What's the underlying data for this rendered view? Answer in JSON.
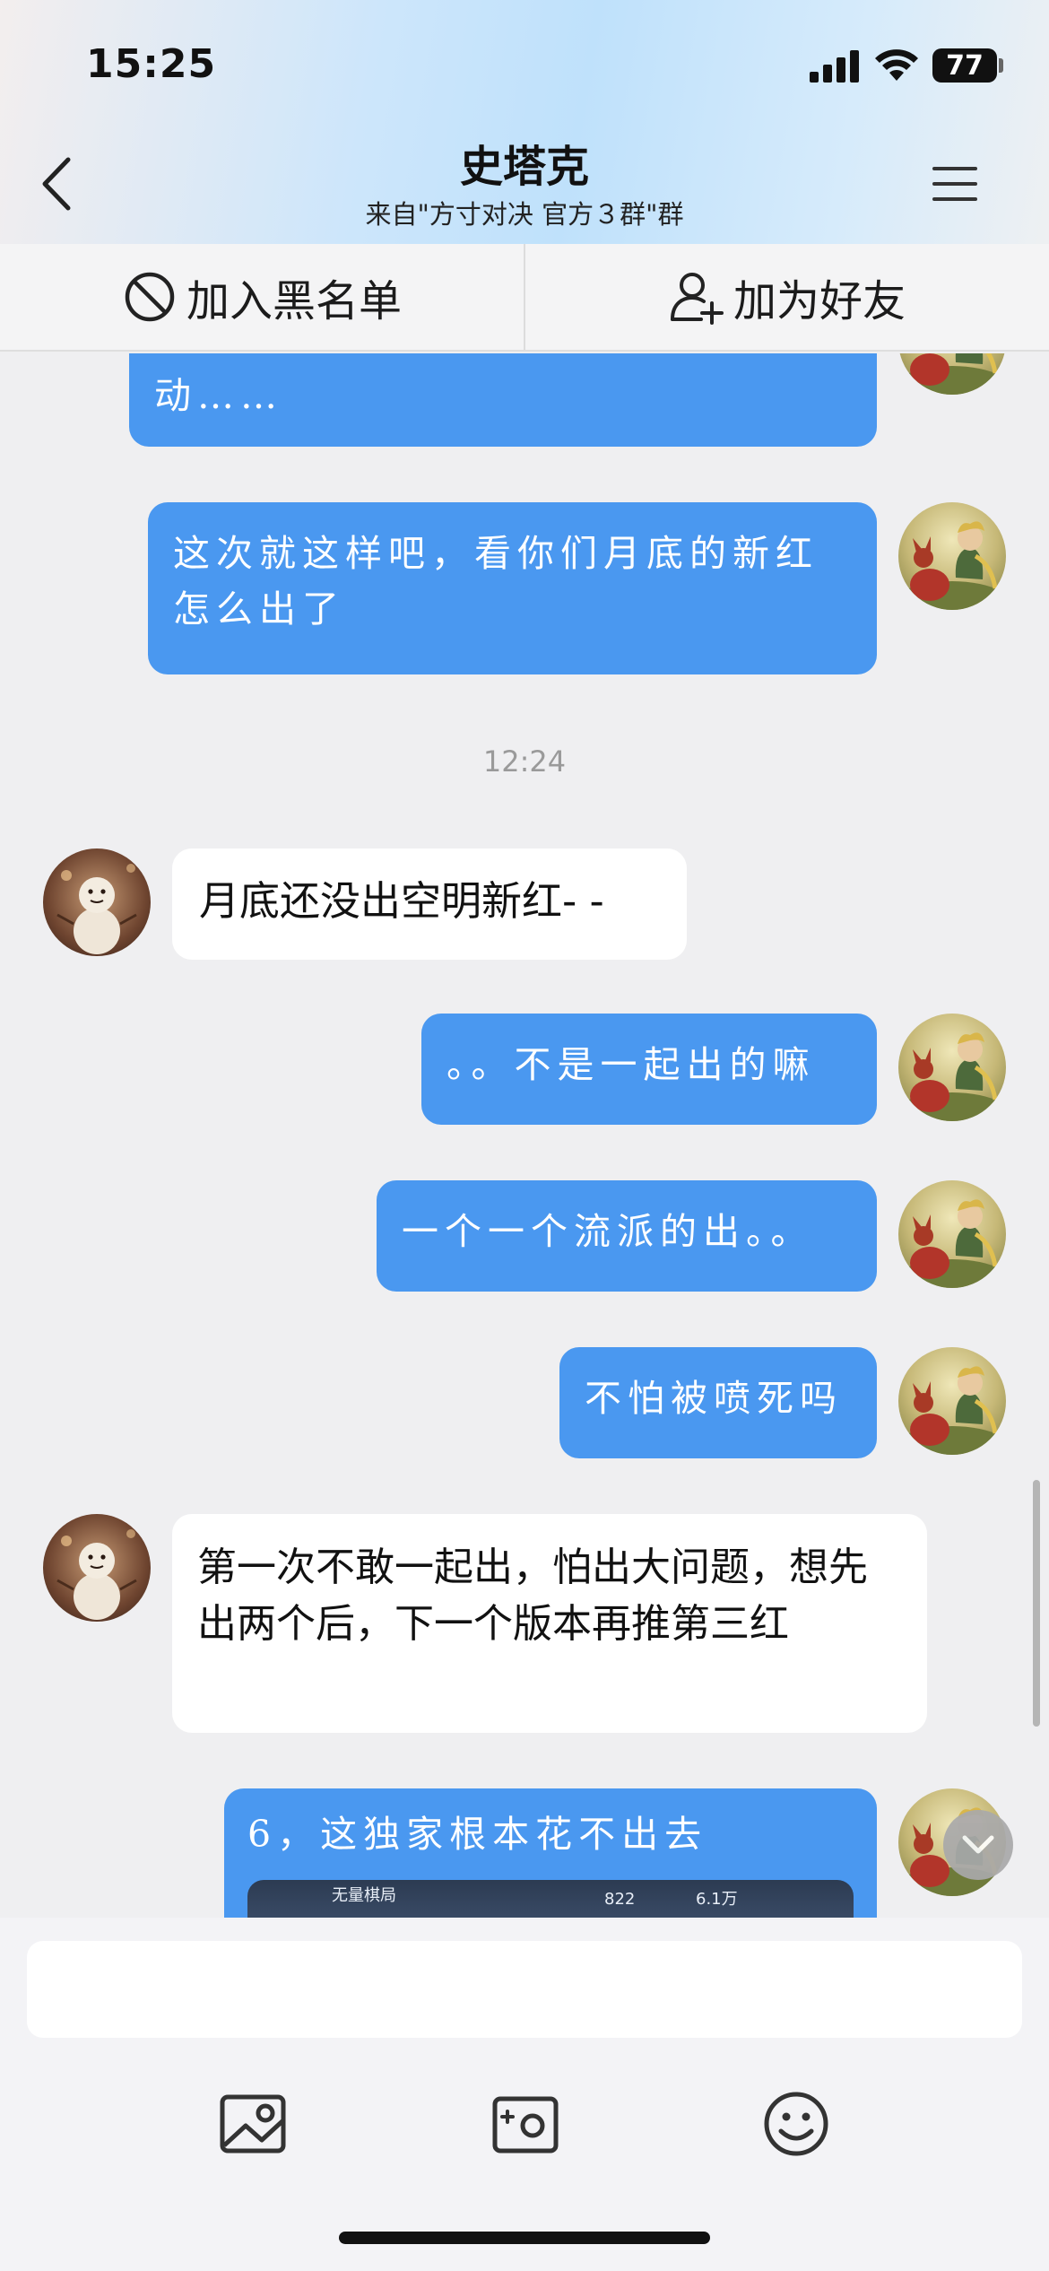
{
  "status": {
    "time": "15:25",
    "battery": "77"
  },
  "header": {
    "title": "史塔克",
    "subtitle": "来自\"方寸对决 官方３群\"群"
  },
  "actions": {
    "block": "加入黑名单",
    "add_friend": "加为好友"
  },
  "messages": [
    {
      "sender": "me",
      "text": "动……"
    },
    {
      "sender": "me",
      "text": "这次就这样吧，看你们月底的新红怎么出了"
    },
    {
      "time": "12:24"
    },
    {
      "sender": "them",
      "text": "月底还没出空明新红- -"
    },
    {
      "sender": "me",
      "text": "。。不是一起出的嘛"
    },
    {
      "sender": "me",
      "text": "一个一个流派的出。。"
    },
    {
      "sender": "me",
      "text": "不怕被喷死吗"
    },
    {
      "sender": "them",
      "text": "第一次不敢一起出，怕出大问题，想先出两个后，下一个版本再推第三红"
    },
    {
      "sender": "me",
      "text": "6，这独家根本花不出去",
      "image": {
        "label": "无量棋局",
        "value1": "822",
        "value2": "6.1万"
      }
    }
  ],
  "colors": {
    "my_bubble": "#4a98f0",
    "their_bubble": "#ffffff",
    "chat_bg": "#efeff1"
  },
  "icons": {
    "back": "chevron-left-icon",
    "menu": "hamburger-menu-icon",
    "block": "no-entry-icon",
    "add_friend": "person-add-icon",
    "photo": "image-icon",
    "camera": "camera-icon",
    "emoji": "smiley-icon",
    "scroll_down": "chevron-down-icon"
  }
}
